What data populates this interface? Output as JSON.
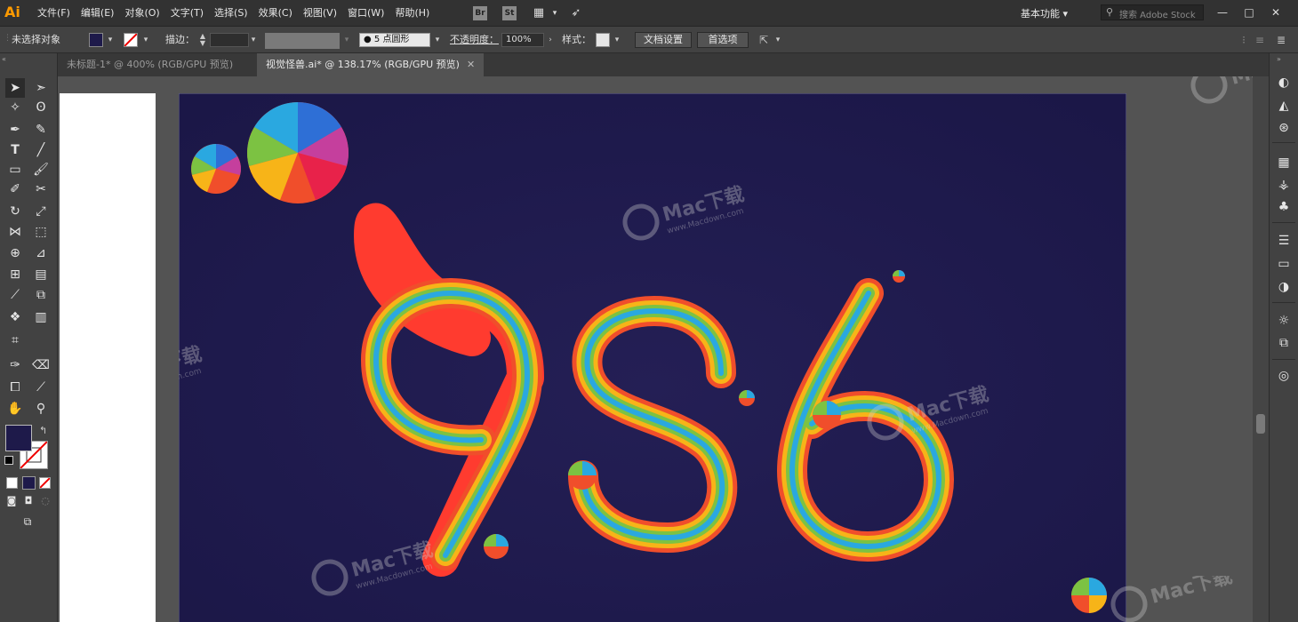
{
  "app": {
    "logo": "Ai"
  },
  "menu": [
    "文件(F)",
    "编辑(E)",
    "对象(O)",
    "文字(T)",
    "选择(S)",
    "效果(C)",
    "视图(V)",
    "窗口(W)",
    "帮助(H)"
  ],
  "menubar_icons": {
    "bridge": "Br",
    "stock": "St"
  },
  "workspace": {
    "label": "基本功能"
  },
  "search": {
    "placeholder": "搜索 Adobe Stock"
  },
  "window_controls": {
    "minimize": "—",
    "maximize": "□",
    "close": "✕"
  },
  "control_bar": {
    "selection_status": "未选择对象",
    "stroke_label": "描边：",
    "brush_size": "5",
    "brush_name": "点圆形",
    "opacity_label": "不透明度：",
    "opacity_value": "100%",
    "style_label": "样式：",
    "doc_settings": "文档设置",
    "preferences": "首选项"
  },
  "tabs": [
    {
      "label": "未标题-1* @ 400% (RGB/GPU 预览)",
      "active": false
    },
    {
      "label": "视觉怪兽.ai* @ 138.17% (RGB/GPU 预览)",
      "active": true
    }
  ],
  "artwork": {
    "text": "956",
    "background": "#1e1a4a",
    "watermark_brand": "Mac下载",
    "watermark_url": "www.Macdown.com"
  },
  "colors": {
    "fill": "#1e1a4a",
    "accent": "#ff9a00"
  }
}
